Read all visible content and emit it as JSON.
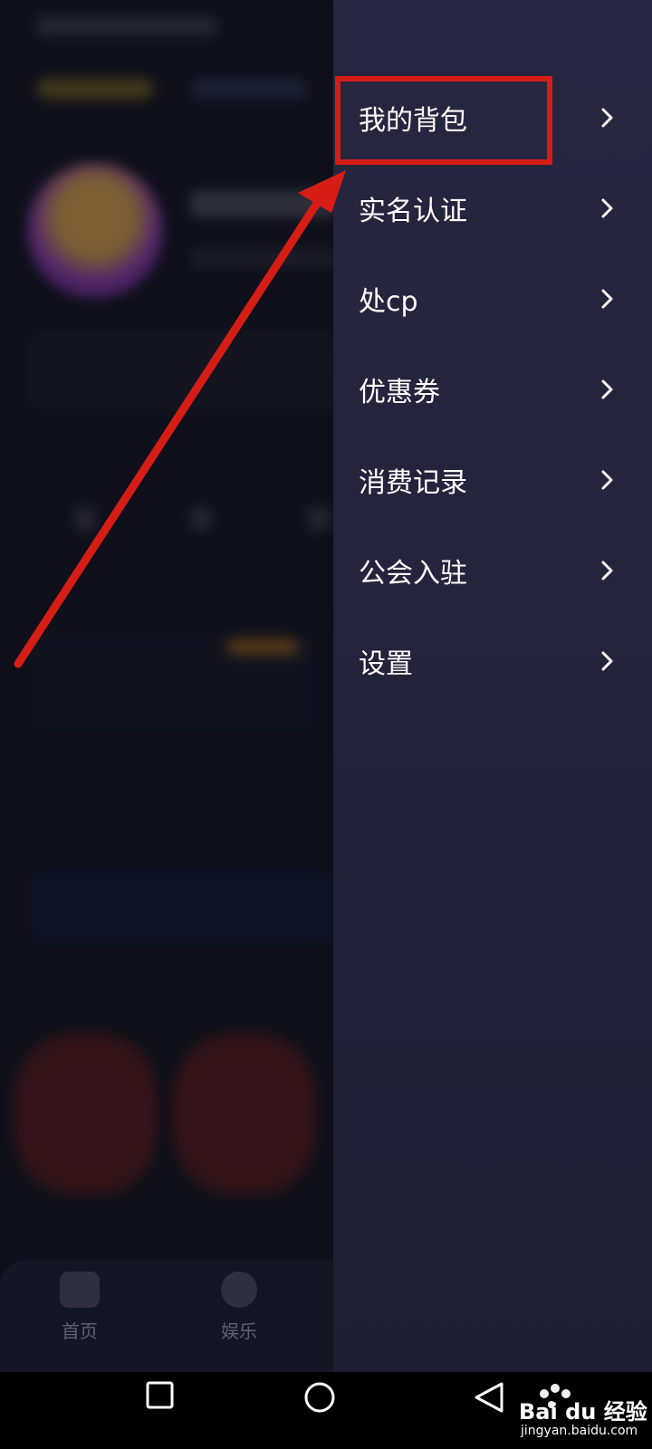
{
  "drawer": {
    "items": [
      {
        "label": "我的背包"
      },
      {
        "label": "实名认证"
      },
      {
        "label": "处cp"
      },
      {
        "label": "优惠券"
      },
      {
        "label": "消费记录"
      },
      {
        "label": "公会入驻"
      },
      {
        "label": "设置"
      }
    ]
  },
  "tabbar": {
    "tabs": [
      {
        "label": "首页"
      },
      {
        "label": "娱乐"
      }
    ]
  },
  "watermark": {
    "logo": "Bai du 经验",
    "url": "jingyan.baidu.com"
  },
  "colors": {
    "highlight": "#d51d16",
    "drawer_bg": "#262640"
  },
  "icons": {
    "chevron": "chevron-right-icon",
    "nav_back": "back-triangle-icon",
    "nav_home": "home-circle-icon",
    "nav_recent": "recent-square-icon"
  }
}
